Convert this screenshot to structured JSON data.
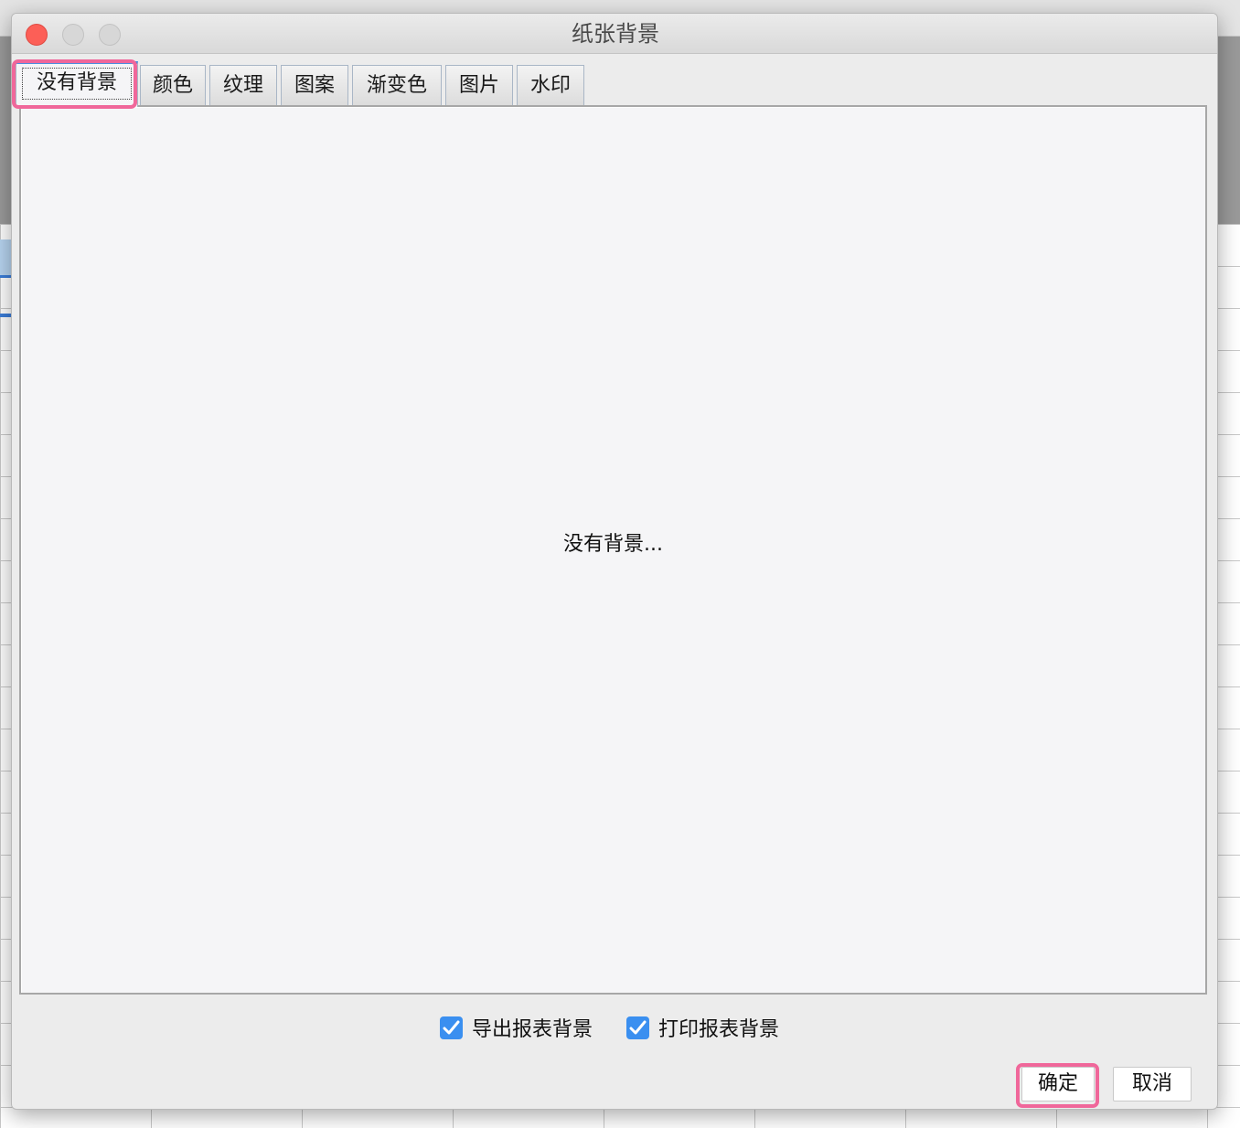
{
  "dialog": {
    "title": "纸张背景",
    "tabs": [
      {
        "label": "没有背景"
      },
      {
        "label": "颜色"
      },
      {
        "label": "纹理"
      },
      {
        "label": "图案"
      },
      {
        "label": "渐变色"
      },
      {
        "label": "图片"
      },
      {
        "label": "水印"
      }
    ],
    "active_tab": "没有背景",
    "panel_message": "没有背景...",
    "options": {
      "export_background": {
        "label": "导出报表背景",
        "checked": true
      },
      "print_background": {
        "label": "打印报表背景",
        "checked": true
      }
    },
    "buttons": {
      "ok": "确定",
      "cancel": "取消"
    }
  },
  "colors": {
    "highlight": "#f0679a",
    "checkbox": "#3a8ff0",
    "close_button": "#fc5f57",
    "active_tab_accent": "#4a8ee0"
  }
}
